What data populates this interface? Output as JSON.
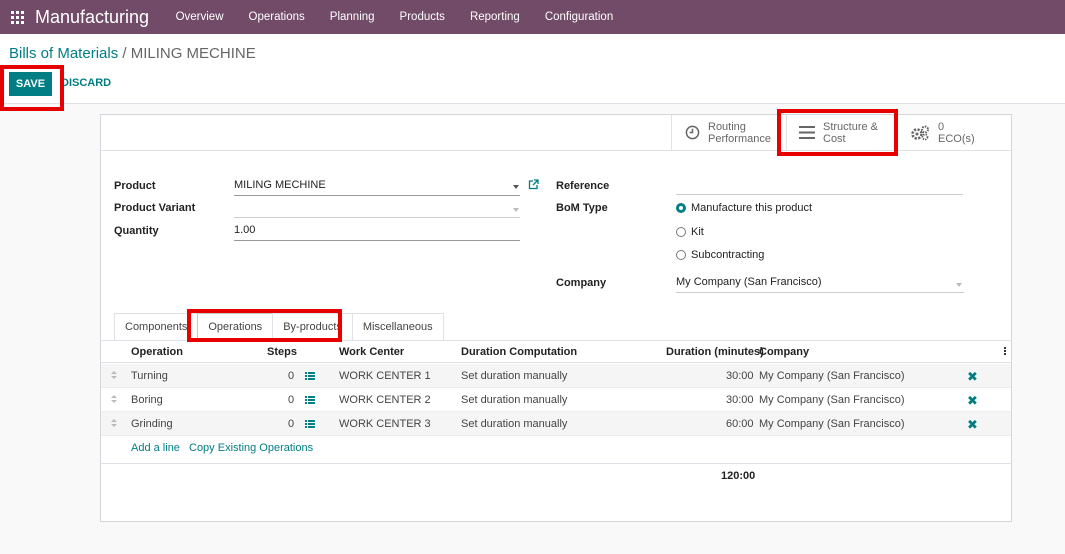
{
  "navbar": {
    "brand": "Manufacturing",
    "menu": [
      "Overview",
      "Operations",
      "Planning",
      "Products",
      "Reporting",
      "Configuration"
    ]
  },
  "breadcrumb": {
    "parent": "Bills of Materials",
    "separator": "/",
    "current": "MILING MECHINE"
  },
  "buttons": {
    "save": "SAVE",
    "discard": "DISCARD"
  },
  "stat_buttons": {
    "routing_line1": "Routing",
    "routing_line2": "Performance",
    "structure_line1": "Structure &",
    "structure_line2": "Cost",
    "eco_count": "0",
    "eco_label": "ECO(s)"
  },
  "form": {
    "product_label": "Product",
    "product_value": "MILING MECHINE",
    "variant_label": "Product Variant",
    "variant_value": "",
    "quantity_label": "Quantity",
    "quantity_value": "1.00",
    "reference_label": "Reference",
    "reference_value": "",
    "bom_type_label": "BoM Type",
    "bom_type_options": [
      "Manufacture this product",
      "Kit",
      "Subcontracting"
    ],
    "bom_type_selected": "Manufacture this product",
    "company_label": "Company",
    "company_value": "My Company (San Francisco)"
  },
  "tabs": [
    "Components",
    "Operations",
    "By-products",
    "Miscellaneous"
  ],
  "active_tab": "Operations",
  "operations_table": {
    "headers": [
      "Operation",
      "Steps",
      "Work Center",
      "Duration Computation",
      "Duration (minutes)",
      "Company"
    ],
    "rows": [
      {
        "operation": "Turning",
        "steps": "0",
        "work_center": "WORK CENTER 1",
        "computation": "Set duration manually",
        "duration": "30:00",
        "company": "My Company (San Francisco)"
      },
      {
        "operation": "Boring",
        "steps": "0",
        "work_center": "WORK CENTER 2",
        "computation": "Set duration manually",
        "duration": "30:00",
        "company": "My Company (San Francisco)"
      },
      {
        "operation": "Grinding",
        "steps": "0",
        "work_center": "WORK CENTER 3",
        "computation": "Set duration manually",
        "duration": "60:00",
        "company": "My Company (San Francisco)"
      }
    ],
    "add_line": "Add a line",
    "copy_operations": "Copy Existing Operations",
    "total_duration": "120:00"
  },
  "colors": {
    "navbar": "#714b67",
    "primary": "#017e84",
    "highlight": "#e60000"
  }
}
